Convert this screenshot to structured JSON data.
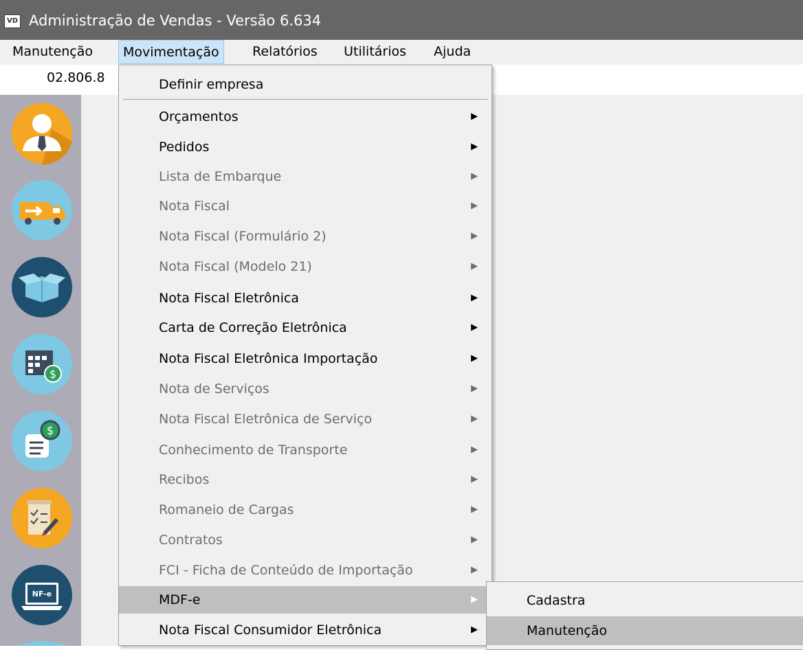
{
  "window": {
    "title": "Administração de Vendas - Versão 6.634",
    "app_icon": "VD"
  },
  "menubar": {
    "items": [
      {
        "label": "Manutenção"
      },
      {
        "label": "Movimentação",
        "active": true
      },
      {
        "label": "Relatórios"
      },
      {
        "label": "Utilitários"
      },
      {
        "label": "Ajuda"
      }
    ]
  },
  "subbar": {
    "text": "02.806.8"
  },
  "toolbar": {
    "icons": [
      "user-manager-icon",
      "delivery-truck-icon",
      "open-box-icon",
      "calendar-money-icon",
      "invoice-dollar-icon",
      "signed-document-icon",
      "nfe-laptop-icon"
    ]
  },
  "dropdown": {
    "items": [
      {
        "label": "Definir empresa",
        "enabled": true,
        "submenu": false
      },
      {
        "label": "Orçamentos",
        "enabled": true,
        "submenu": true
      },
      {
        "label": "Pedidos",
        "enabled": true,
        "submenu": true
      },
      {
        "label": "Lista de Embarque",
        "enabled": false,
        "submenu": true
      },
      {
        "label": "Nota Fiscal",
        "enabled": false,
        "submenu": true
      },
      {
        "label": "Nota Fiscal (Formulário 2)",
        "enabled": false,
        "submenu": true
      },
      {
        "label": "Nota Fiscal (Modelo 21)",
        "enabled": false,
        "submenu": true
      },
      {
        "label": "Nota Fiscal Eletrônica",
        "enabled": true,
        "submenu": true
      },
      {
        "label": "Carta de Correção Eletrônica",
        "enabled": true,
        "submenu": true
      },
      {
        "label": "Nota Fiscal Eletrônica Importação",
        "enabled": true,
        "submenu": true
      },
      {
        "label": "Nota de Serviços",
        "enabled": false,
        "submenu": true
      },
      {
        "label": "Nota Fiscal Eletrônica de Serviço",
        "enabled": false,
        "submenu": true
      },
      {
        "label": "Conhecimento de Transporte",
        "enabled": false,
        "submenu": true
      },
      {
        "label": "Recibos",
        "enabled": false,
        "submenu": true
      },
      {
        "label": "Romaneio de Cargas",
        "enabled": false,
        "submenu": true
      },
      {
        "label": "Contratos",
        "enabled": false,
        "submenu": true
      },
      {
        "label": "FCI - Ficha de Conteúdo de Importação",
        "enabled": false,
        "submenu": true
      },
      {
        "label": "MDF-e",
        "enabled": true,
        "submenu": true,
        "highlighted": true
      },
      {
        "label": "Nota Fiscal Consumidor Eletrônica",
        "enabled": true,
        "submenu": true
      }
    ]
  },
  "submenu": {
    "items": [
      {
        "label": "Cadastra"
      },
      {
        "label": "Manutenção",
        "highlighted": true
      }
    ]
  }
}
